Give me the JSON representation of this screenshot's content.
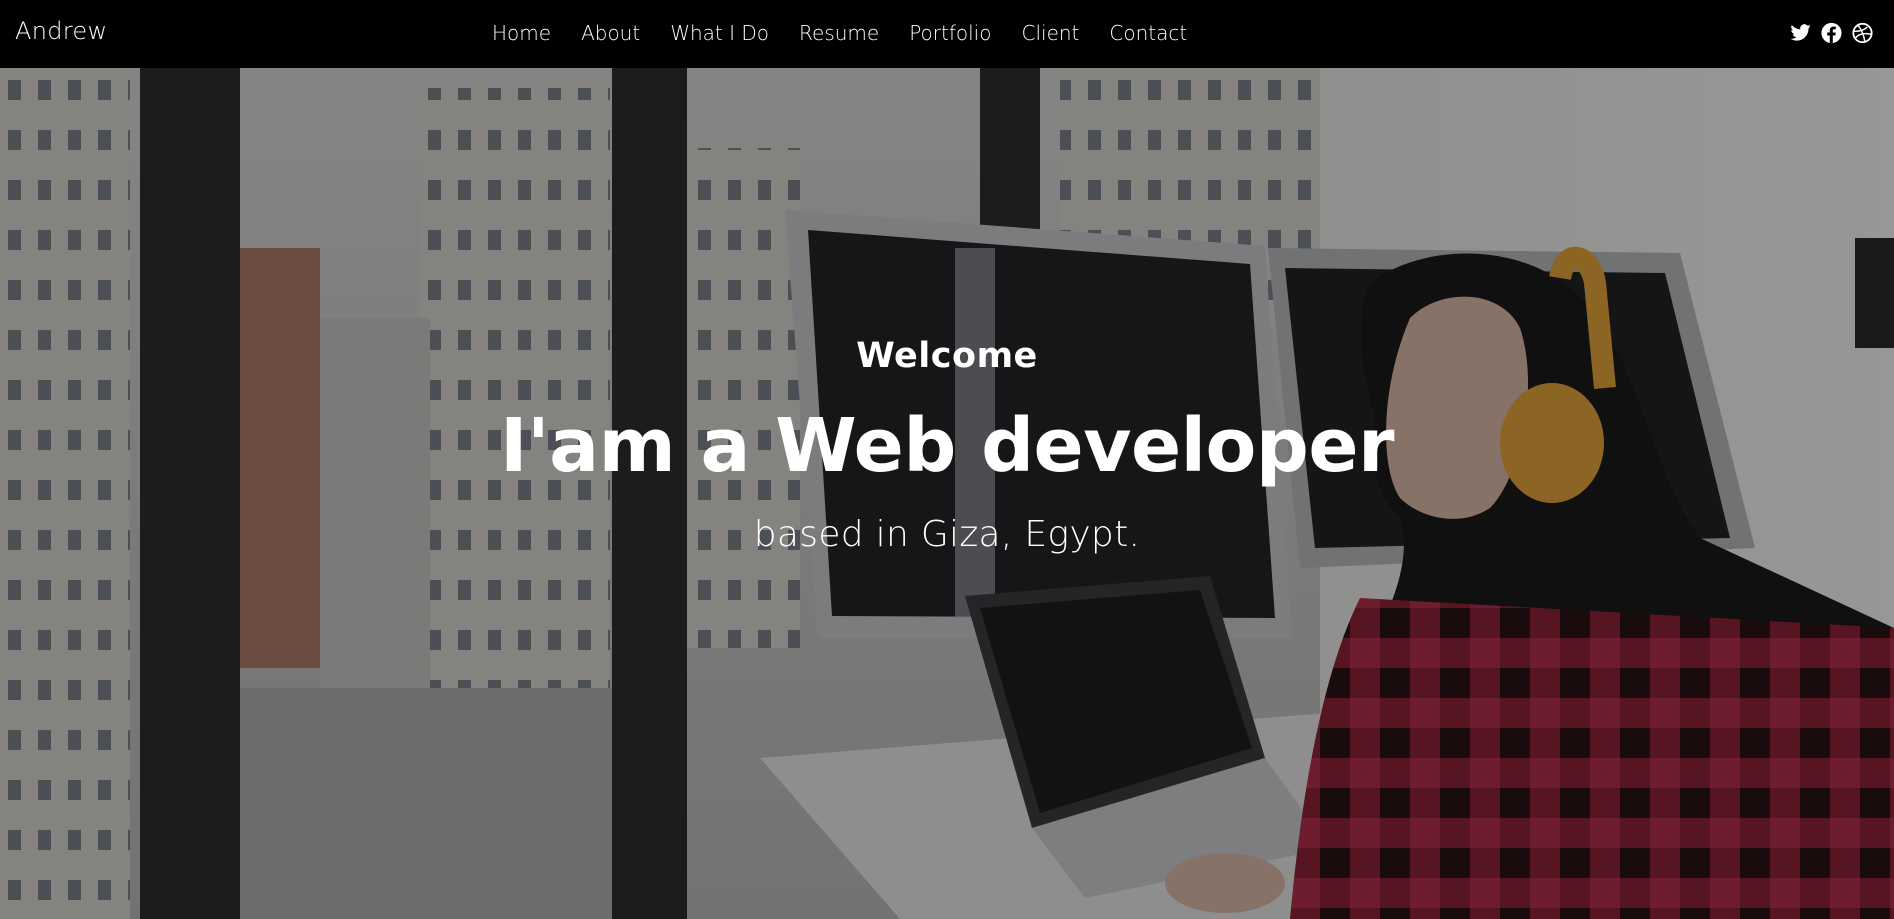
{
  "navbar": {
    "brand": "Andrew",
    "links": [
      "Home",
      "About",
      "What I Do",
      "Resume",
      "Portfolio",
      "Client",
      "Contact"
    ],
    "social": [
      {
        "icon": "twitter-icon"
      },
      {
        "icon": "facebook-icon"
      },
      {
        "icon": "dribbble-icon"
      }
    ]
  },
  "hero": {
    "welcome": "Welcome",
    "headline": "I'am a Web developer",
    "subline": "based in Giza, Egypt.",
    "image": "woman-coding-at-desk-photo"
  },
  "colors": {
    "navbar_bg": "#000000",
    "text": "#ffffff",
    "headphones": "#e3a23b",
    "shirt": "#8c2234"
  }
}
